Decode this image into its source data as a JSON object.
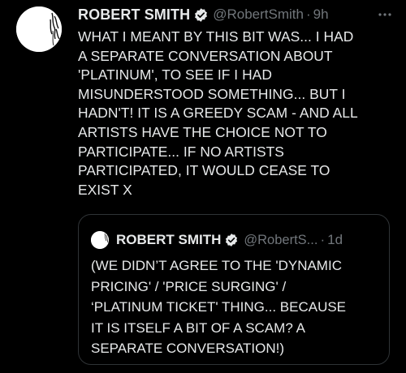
{
  "tweet": {
    "author_name": "ROBERT SMITH",
    "handle": "@RobertSmith",
    "separator": "·",
    "time": "9h",
    "more_icon": "more-horizontal-icon",
    "verified_icon": "verified-badge-icon",
    "text": "WHAT I MEANT BY THIS BIT WAS... I HAD\nA SEPARATE CONVERSATION ABOUT\n'PLATINUM', TO SEE IF I HAD\nMISUNDERSTOOD SOMETHING... BUT I\nHADN'T! IT IS A GREEDY SCAM - AND ALL\nARTISTS HAVE THE CHOICE NOT TO\nPARTICIPATE... IF NO ARTISTS\nPARTICIPATED, IT WOULD CEASE TO\nEXIST X"
  },
  "quoted_tweet": {
    "author_name": "ROBERT SMITH",
    "handle": "@RobertS...",
    "separator": "·",
    "time": "1d",
    "text": "(WE DIDN’T AGREE TO THE 'DYNAMIC\nPRICING' / 'PRICE SURGING' /\n‘PLATINUM TICKET' THING... BECAUSE\nIT IS ITSELF A BIT OF A SCAM? A\nSEPARATE CONVERSATION!)"
  },
  "colors": {
    "background": "#000000",
    "text": "#e7e9ea",
    "secondary": "#71767b",
    "border": "#2f3336"
  }
}
